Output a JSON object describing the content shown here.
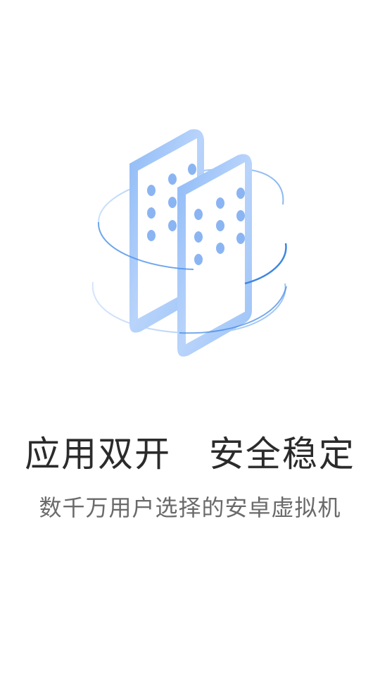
{
  "splash": {
    "headline": "应用双开   安全稳定",
    "subline": "数千万用户选择的安卓虚拟机",
    "illustration_icon": "dual-phones-icon"
  },
  "colors": {
    "background": "#ffffff",
    "headline_text": "#2b2b2b",
    "subline_text": "#6a6a6a",
    "accent_blue": "#4a90e8",
    "light_blue": "#bcd6fb"
  }
}
